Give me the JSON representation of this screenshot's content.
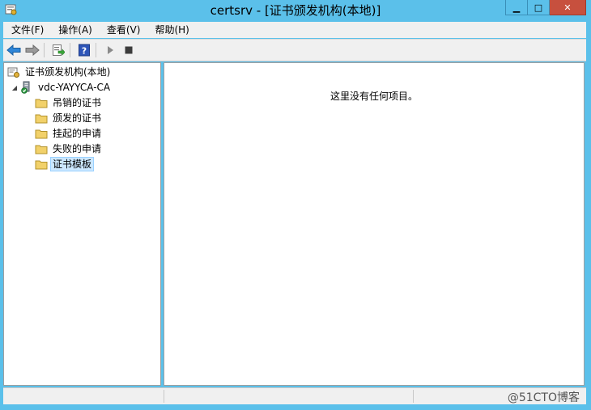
{
  "window": {
    "title": "certsrv - [证书颁发机构(本地)]",
    "controls": {
      "minimize": "▁",
      "maximize": "□",
      "close": "✕"
    }
  },
  "menubar": {
    "items": [
      {
        "label": "文件(F)"
      },
      {
        "label": "操作(A)"
      },
      {
        "label": "查看(V)"
      },
      {
        "label": "帮助(H)"
      }
    ]
  },
  "toolbar": {
    "icons": [
      "back-arrow-icon",
      "forward-arrow-icon",
      "export-list-icon",
      "help-icon",
      "play-icon",
      "stop-icon"
    ]
  },
  "tree": {
    "root": {
      "label": "证书颁发机构(本地)",
      "icon": "certsrv-icon"
    },
    "ca": {
      "label": "vdc-YAYYCA-CA",
      "icon": "ca-server-icon",
      "expander": "◢"
    },
    "folders": [
      {
        "label": "吊销的证书"
      },
      {
        "label": "颁发的证书"
      },
      {
        "label": "挂起的申请"
      },
      {
        "label": "失败的申请"
      },
      {
        "label": "证书模板",
        "selected": true
      }
    ]
  },
  "content": {
    "empty_message": "这里没有任何项目。"
  },
  "statusbar": {
    "watermark": "@51CTO博客"
  },
  "colors": {
    "titlebar": "#5bc0ea",
    "close_button": "#c7503e",
    "selection": "#cce8ff",
    "folder": "#f2d16a"
  }
}
